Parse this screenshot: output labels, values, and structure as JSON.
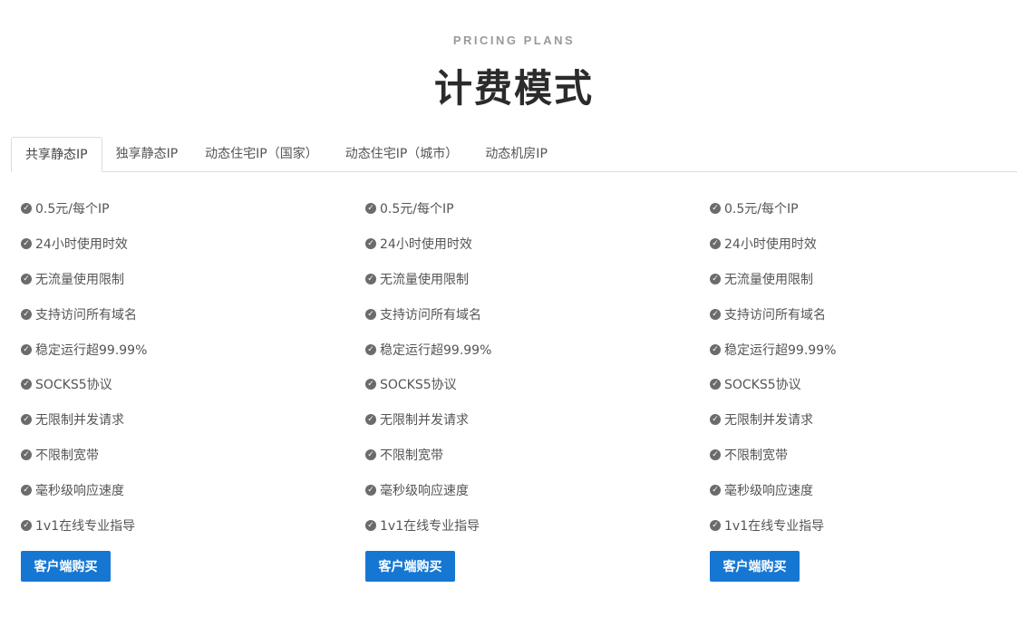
{
  "header": {
    "subtitle": "PRICING PLANS",
    "title": "计费模式"
  },
  "tabs": [
    {
      "label": "共享静态IP",
      "active": true
    },
    {
      "label": "独享静态IP",
      "active": false
    },
    {
      "label": "动态住宅IP（国家）",
      "active": false
    },
    {
      "label": "动态住宅IP（城市）",
      "active": false
    },
    {
      "label": "动态机房IP",
      "active": false
    }
  ],
  "plans": [
    {
      "features": [
        "0.5元/每个IP",
        "24小时使用时效",
        "无流量使用限制",
        "支持访问所有域名",
        "稳定运行超99.99%",
        "SOCKS5协议",
        "无限制并发请求",
        "不限制宽带",
        "毫秒级响应速度",
        "1v1在线专业指导"
      ],
      "button_label": "客户端购买"
    },
    {
      "features": [
        "0.5元/每个IP",
        "24小时使用时效",
        "无流量使用限制",
        "支持访问所有域名",
        "稳定运行超99.99%",
        "SOCKS5协议",
        "无限制并发请求",
        "不限制宽带",
        "毫秒级响应速度",
        "1v1在线专业指导"
      ],
      "button_label": "客户端购买"
    },
    {
      "features": [
        "0.5元/每个IP",
        "24小时使用时效",
        "无流量使用限制",
        "支持访问所有域名",
        "稳定运行超99.99%",
        "SOCKS5协议",
        "无限制并发请求",
        "不限制宽带",
        "毫秒级响应速度",
        "1v1在线专业指导"
      ],
      "button_label": "客户端购买"
    }
  ],
  "icons": {
    "check": "check-circle-icon"
  },
  "colors": {
    "accent": "#1677d2",
    "title": "#2b2b2b",
    "subtitle": "#9a9a9a",
    "text": "#555555"
  }
}
